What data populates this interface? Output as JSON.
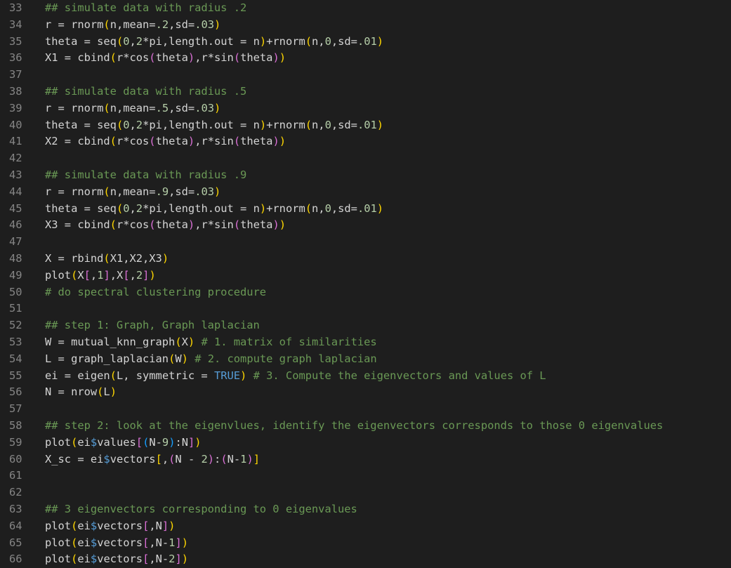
{
  "editor": {
    "language": "R",
    "colors": {
      "background": "#1e1e1e",
      "line_number": "#858585",
      "comment": "#6a9955",
      "number": "#b5cea8",
      "constant": "#569cd6",
      "text": "#d4d4d4",
      "bracket_level_1": "#ffd700",
      "bracket_level_2": "#da70d6",
      "bracket_level_3": "#179fff"
    },
    "lines": [
      {
        "number": "33",
        "tokens": [
          {
            "t": "comment",
            "v": "## simulate data with radius .2"
          }
        ]
      },
      {
        "number": "34",
        "tokens": [
          {
            "t": "text",
            "v": "r = rnorm"
          },
          {
            "t": "b1",
            "v": "("
          },
          {
            "t": "text",
            "v": "n,mean="
          },
          {
            "t": "num",
            "v": ".2"
          },
          {
            "t": "text",
            "v": ",sd="
          },
          {
            "t": "num",
            "v": ".03"
          },
          {
            "t": "b1",
            "v": ")"
          }
        ]
      },
      {
        "number": "35",
        "tokens": [
          {
            "t": "text",
            "v": "theta = seq"
          },
          {
            "t": "b1",
            "v": "("
          },
          {
            "t": "num",
            "v": "0"
          },
          {
            "t": "text",
            "v": ","
          },
          {
            "t": "num",
            "v": "2"
          },
          {
            "t": "text",
            "v": "*pi,length.out = n"
          },
          {
            "t": "b1",
            "v": ")"
          },
          {
            "t": "text",
            "v": "+rnorm"
          },
          {
            "t": "b1",
            "v": "("
          },
          {
            "t": "text",
            "v": "n,"
          },
          {
            "t": "num",
            "v": "0"
          },
          {
            "t": "text",
            "v": ",sd="
          },
          {
            "t": "num",
            "v": ".01"
          },
          {
            "t": "b1",
            "v": ")"
          }
        ]
      },
      {
        "number": "36",
        "tokens": [
          {
            "t": "text",
            "v": "X1 = cbind"
          },
          {
            "t": "b1",
            "v": "("
          },
          {
            "t": "text",
            "v": "r*cos"
          },
          {
            "t": "b2",
            "v": "("
          },
          {
            "t": "text",
            "v": "theta"
          },
          {
            "t": "b2",
            "v": ")"
          },
          {
            "t": "text",
            "v": ",r*sin"
          },
          {
            "t": "b2",
            "v": "("
          },
          {
            "t": "text",
            "v": "theta"
          },
          {
            "t": "b2",
            "v": ")"
          },
          {
            "t": "b1",
            "v": ")"
          }
        ]
      },
      {
        "number": "37",
        "tokens": []
      },
      {
        "number": "38",
        "tokens": [
          {
            "t": "comment",
            "v": "## simulate data with radius .5"
          }
        ]
      },
      {
        "number": "39",
        "tokens": [
          {
            "t": "text",
            "v": "r = rnorm"
          },
          {
            "t": "b1",
            "v": "("
          },
          {
            "t": "text",
            "v": "n,mean="
          },
          {
            "t": "num",
            "v": ".5"
          },
          {
            "t": "text",
            "v": ",sd="
          },
          {
            "t": "num",
            "v": ".03"
          },
          {
            "t": "b1",
            "v": ")"
          }
        ]
      },
      {
        "number": "40",
        "tokens": [
          {
            "t": "text",
            "v": "theta = seq"
          },
          {
            "t": "b1",
            "v": "("
          },
          {
            "t": "num",
            "v": "0"
          },
          {
            "t": "text",
            "v": ","
          },
          {
            "t": "num",
            "v": "2"
          },
          {
            "t": "text",
            "v": "*pi,length.out = n"
          },
          {
            "t": "b1",
            "v": ")"
          },
          {
            "t": "text",
            "v": "+rnorm"
          },
          {
            "t": "b1",
            "v": "("
          },
          {
            "t": "text",
            "v": "n,"
          },
          {
            "t": "num",
            "v": "0"
          },
          {
            "t": "text",
            "v": ",sd="
          },
          {
            "t": "num",
            "v": ".01"
          },
          {
            "t": "b1",
            "v": ")"
          }
        ]
      },
      {
        "number": "41",
        "tokens": [
          {
            "t": "text",
            "v": "X2 = cbind"
          },
          {
            "t": "b1",
            "v": "("
          },
          {
            "t": "text",
            "v": "r*cos"
          },
          {
            "t": "b2",
            "v": "("
          },
          {
            "t": "text",
            "v": "theta"
          },
          {
            "t": "b2",
            "v": ")"
          },
          {
            "t": "text",
            "v": ",r*sin"
          },
          {
            "t": "b2",
            "v": "("
          },
          {
            "t": "text",
            "v": "theta"
          },
          {
            "t": "b2",
            "v": ")"
          },
          {
            "t": "b1",
            "v": ")"
          }
        ]
      },
      {
        "number": "42",
        "tokens": []
      },
      {
        "number": "43",
        "tokens": [
          {
            "t": "comment",
            "v": "## simulate data with radius .9"
          }
        ]
      },
      {
        "number": "44",
        "tokens": [
          {
            "t": "text",
            "v": "r = rnorm"
          },
          {
            "t": "b1",
            "v": "("
          },
          {
            "t": "text",
            "v": "n,mean="
          },
          {
            "t": "num",
            "v": ".9"
          },
          {
            "t": "text",
            "v": ",sd="
          },
          {
            "t": "num",
            "v": ".03"
          },
          {
            "t": "b1",
            "v": ")"
          }
        ]
      },
      {
        "number": "45",
        "tokens": [
          {
            "t": "text",
            "v": "theta = seq"
          },
          {
            "t": "b1",
            "v": "("
          },
          {
            "t": "num",
            "v": "0"
          },
          {
            "t": "text",
            "v": ","
          },
          {
            "t": "num",
            "v": "2"
          },
          {
            "t": "text",
            "v": "*pi,length.out = n"
          },
          {
            "t": "b1",
            "v": ")"
          },
          {
            "t": "text",
            "v": "+rnorm"
          },
          {
            "t": "b1",
            "v": "("
          },
          {
            "t": "text",
            "v": "n,"
          },
          {
            "t": "num",
            "v": "0"
          },
          {
            "t": "text",
            "v": ",sd="
          },
          {
            "t": "num",
            "v": ".01"
          },
          {
            "t": "b1",
            "v": ")"
          }
        ]
      },
      {
        "number": "46",
        "tokens": [
          {
            "t": "text",
            "v": "X3 = cbind"
          },
          {
            "t": "b1",
            "v": "("
          },
          {
            "t": "text",
            "v": "r*cos"
          },
          {
            "t": "b2",
            "v": "("
          },
          {
            "t": "text",
            "v": "theta"
          },
          {
            "t": "b2",
            "v": ")"
          },
          {
            "t": "text",
            "v": ",r*sin"
          },
          {
            "t": "b2",
            "v": "("
          },
          {
            "t": "text",
            "v": "theta"
          },
          {
            "t": "b2",
            "v": ")"
          },
          {
            "t": "b1",
            "v": ")"
          }
        ]
      },
      {
        "number": "47",
        "tokens": []
      },
      {
        "number": "48",
        "tokens": [
          {
            "t": "text",
            "v": "X = rbind"
          },
          {
            "t": "b1",
            "v": "("
          },
          {
            "t": "text",
            "v": "X1,X2,X3"
          },
          {
            "t": "b1",
            "v": ")"
          }
        ]
      },
      {
        "number": "49",
        "tokens": [
          {
            "t": "text",
            "v": "plot"
          },
          {
            "t": "b1",
            "v": "("
          },
          {
            "t": "text",
            "v": "X"
          },
          {
            "t": "b2",
            "v": "["
          },
          {
            "t": "text",
            "v": ","
          },
          {
            "t": "num",
            "v": "1"
          },
          {
            "t": "b2",
            "v": "]"
          },
          {
            "t": "text",
            "v": ",X"
          },
          {
            "t": "b2",
            "v": "["
          },
          {
            "t": "text",
            "v": ","
          },
          {
            "t": "num",
            "v": "2"
          },
          {
            "t": "b2",
            "v": "]"
          },
          {
            "t": "b1",
            "v": ")"
          }
        ]
      },
      {
        "number": "50",
        "tokens": [
          {
            "t": "comment",
            "v": "# do spectral clustering procedure"
          }
        ]
      },
      {
        "number": "51",
        "tokens": []
      },
      {
        "number": "52",
        "tokens": [
          {
            "t": "comment",
            "v": "## step 1: Graph, Graph laplacian"
          }
        ]
      },
      {
        "number": "53",
        "tokens": [
          {
            "t": "text",
            "v": "W = mutual_knn_graph"
          },
          {
            "t": "b1",
            "v": "("
          },
          {
            "t": "text",
            "v": "X"
          },
          {
            "t": "b1",
            "v": ")"
          },
          {
            "t": "text",
            "v": " "
          },
          {
            "t": "comment",
            "v": "# 1. matrix of similarities"
          }
        ]
      },
      {
        "number": "54",
        "tokens": [
          {
            "t": "text",
            "v": "L = graph_laplacian"
          },
          {
            "t": "b1",
            "v": "("
          },
          {
            "t": "text",
            "v": "W"
          },
          {
            "t": "b1",
            "v": ")"
          },
          {
            "t": "text",
            "v": " "
          },
          {
            "t": "comment",
            "v": "# 2. compute graph laplacian"
          }
        ]
      },
      {
        "number": "55",
        "tokens": [
          {
            "t": "text",
            "v": "ei = eigen"
          },
          {
            "t": "b1",
            "v": "("
          },
          {
            "t": "text",
            "v": "L, symmetric = "
          },
          {
            "t": "const",
            "v": "TRUE"
          },
          {
            "t": "b1",
            "v": ")"
          },
          {
            "t": "text",
            "v": " "
          },
          {
            "t": "comment",
            "v": "# 3. Compute the eigenvectors and values of L"
          }
        ]
      },
      {
        "number": "56",
        "tokens": [
          {
            "t": "text",
            "v": "N = nrow"
          },
          {
            "t": "b1",
            "v": "("
          },
          {
            "t": "text",
            "v": "L"
          },
          {
            "t": "b1",
            "v": ")"
          }
        ]
      },
      {
        "number": "57",
        "tokens": []
      },
      {
        "number": "58",
        "tokens": [
          {
            "t": "comment",
            "v": "## step 2: look at the eigenvlues, identify the eigenvectors corresponds to those 0 eigenvalues"
          }
        ]
      },
      {
        "number": "59",
        "tokens": [
          {
            "t": "text",
            "v": "plot"
          },
          {
            "t": "b1",
            "v": "("
          },
          {
            "t": "text",
            "v": "ei"
          },
          {
            "t": "dollar",
            "v": "$"
          },
          {
            "t": "text",
            "v": "values"
          },
          {
            "t": "b2",
            "v": "["
          },
          {
            "t": "b3",
            "v": "("
          },
          {
            "t": "text",
            "v": "N-"
          },
          {
            "t": "num",
            "v": "9"
          },
          {
            "t": "b3",
            "v": ")"
          },
          {
            "t": "text",
            "v": ":N"
          },
          {
            "t": "b2",
            "v": "]"
          },
          {
            "t": "b1",
            "v": ")"
          }
        ]
      },
      {
        "number": "60",
        "tokens": [
          {
            "t": "text",
            "v": "X_sc = ei"
          },
          {
            "t": "dollar",
            "v": "$"
          },
          {
            "t": "text",
            "v": "vectors"
          },
          {
            "t": "b1",
            "v": "["
          },
          {
            "t": "text",
            "v": ","
          },
          {
            "t": "b2",
            "v": "("
          },
          {
            "t": "text",
            "v": "N - "
          },
          {
            "t": "num",
            "v": "2"
          },
          {
            "t": "b2",
            "v": ")"
          },
          {
            "t": "text",
            "v": ":"
          },
          {
            "t": "b2",
            "v": "("
          },
          {
            "t": "text",
            "v": "N-"
          },
          {
            "t": "num",
            "v": "1"
          },
          {
            "t": "b2",
            "v": ")"
          },
          {
            "t": "b1",
            "v": "]"
          }
        ]
      },
      {
        "number": "61",
        "tokens": []
      },
      {
        "number": "62",
        "tokens": []
      },
      {
        "number": "63",
        "tokens": [
          {
            "t": "comment",
            "v": "## 3 eigenvectors corresponding to 0 eigenvalues"
          }
        ]
      },
      {
        "number": "64",
        "tokens": [
          {
            "t": "text",
            "v": "plot"
          },
          {
            "t": "b1",
            "v": "("
          },
          {
            "t": "text",
            "v": "ei"
          },
          {
            "t": "dollar",
            "v": "$"
          },
          {
            "t": "text",
            "v": "vectors"
          },
          {
            "t": "b2",
            "v": "["
          },
          {
            "t": "text",
            "v": ",N"
          },
          {
            "t": "b2",
            "v": "]"
          },
          {
            "t": "b1",
            "v": ")"
          }
        ]
      },
      {
        "number": "65",
        "tokens": [
          {
            "t": "text",
            "v": "plot"
          },
          {
            "t": "b1",
            "v": "("
          },
          {
            "t": "text",
            "v": "ei"
          },
          {
            "t": "dollar",
            "v": "$"
          },
          {
            "t": "text",
            "v": "vectors"
          },
          {
            "t": "b2",
            "v": "["
          },
          {
            "t": "text",
            "v": ",N-"
          },
          {
            "t": "num",
            "v": "1"
          },
          {
            "t": "b2",
            "v": "]"
          },
          {
            "t": "b1",
            "v": ")"
          }
        ]
      },
      {
        "number": "66",
        "tokens": [
          {
            "t": "text",
            "v": "plot"
          },
          {
            "t": "b1",
            "v": "("
          },
          {
            "t": "text",
            "v": "ei"
          },
          {
            "t": "dollar",
            "v": "$"
          },
          {
            "t": "text",
            "v": "vectors"
          },
          {
            "t": "b2",
            "v": "["
          },
          {
            "t": "text",
            "v": ",N-"
          },
          {
            "t": "num",
            "v": "2"
          },
          {
            "t": "b2",
            "v": "]"
          },
          {
            "t": "b1",
            "v": ")"
          }
        ]
      }
    ]
  }
}
